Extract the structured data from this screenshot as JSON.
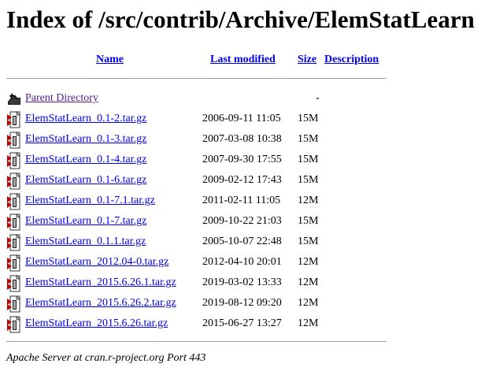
{
  "page": {
    "title": "Index of /src/contrib/Archive/ElemStatLearn"
  },
  "table": {
    "headers": {
      "name": "Name",
      "last_modified": "Last modified",
      "size": "Size",
      "description": "Description"
    },
    "parent": {
      "label": "Parent Directory",
      "size": "-",
      "icon": "back-folder-icon"
    },
    "rows": [
      {
        "name": "ElemStatLearn_0.1-2.tar.gz",
        "modified": "2006-09-11 11:05",
        "size": "15M",
        "icon": "compressed-file-icon"
      },
      {
        "name": "ElemStatLearn_0.1-3.tar.gz",
        "modified": "2007-03-08 10:38",
        "size": "15M",
        "icon": "compressed-file-icon"
      },
      {
        "name": "ElemStatLearn_0.1-4.tar.gz",
        "modified": "2007-09-30 17:55",
        "size": "15M",
        "icon": "compressed-file-icon"
      },
      {
        "name": "ElemStatLearn_0.1-6.tar.gz",
        "modified": "2009-02-12 17:43",
        "size": "15M",
        "icon": "compressed-file-icon"
      },
      {
        "name": "ElemStatLearn_0.1-7.1.tar.gz",
        "modified": "2011-02-11 11:05",
        "size": "12M",
        "icon": "compressed-file-icon"
      },
      {
        "name": "ElemStatLearn_0.1-7.tar.gz",
        "modified": "2009-10-22 21:03",
        "size": "15M",
        "icon": "compressed-file-icon"
      },
      {
        "name": "ElemStatLearn_0.1.1.tar.gz",
        "modified": "2005-10-07 22:48",
        "size": "15M",
        "icon": "compressed-file-icon"
      },
      {
        "name": "ElemStatLearn_2012.04-0.tar.gz",
        "modified": "2012-04-10 20:01",
        "size": "12M",
        "icon": "compressed-file-icon"
      },
      {
        "name": "ElemStatLearn_2015.6.26.1.tar.gz",
        "modified": "2019-03-02 13:33",
        "size": "12M",
        "icon": "compressed-file-icon"
      },
      {
        "name": "ElemStatLearn_2015.6.26.2.tar.gz",
        "modified": "2019-08-12 09:20",
        "size": "12M",
        "icon": "compressed-file-icon"
      },
      {
        "name": "ElemStatLearn_2015.6.26.tar.gz",
        "modified": "2015-06-27 13:27",
        "size": "12M",
        "icon": "compressed-file-icon"
      }
    ]
  },
  "footer": {
    "text": "Apache Server at cran.r-project.org Port 443"
  },
  "colors": {
    "link": "#0000ee",
    "visited_link": "#551a8b",
    "rule": "#a0a0a0"
  }
}
